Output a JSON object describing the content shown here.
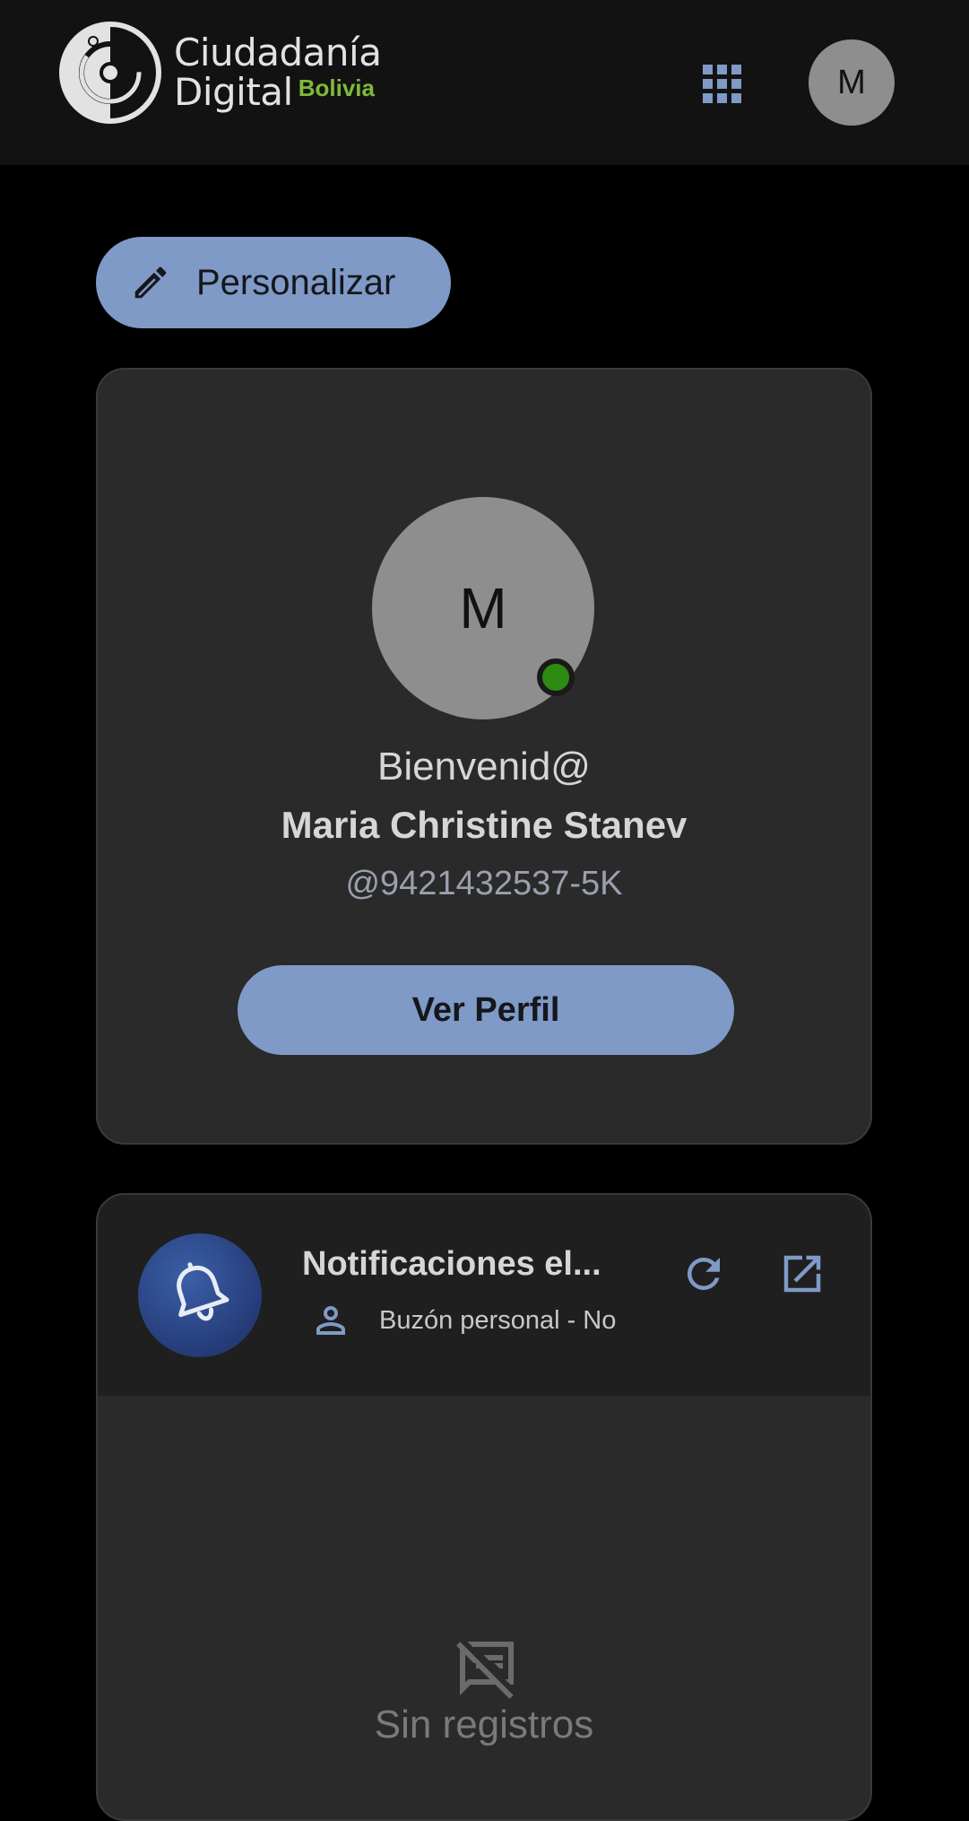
{
  "header": {
    "logo_line1": "Ciudadanía",
    "logo_line2": "Digital",
    "logo_country": "Bolivia",
    "apps_icon": "grid-apps-icon",
    "avatar_initial": "M"
  },
  "toolbar": {
    "personalize_label": "Personalizar",
    "personalize_icon": "pencil-icon"
  },
  "profile": {
    "avatar_initial": "M",
    "status": "online",
    "welcome": "Bienvenid@",
    "full_name": "Maria Christine Stanev",
    "username": "@9421432537-5K",
    "view_profile_label": "Ver Perfil"
  },
  "notifications": {
    "title": "Notificaciones el...",
    "subtitle": "Buzón personal - No",
    "icon": "bell-icon",
    "person_icon": "person-icon",
    "refresh_icon": "refresh-icon",
    "open_icon": "open-external-icon",
    "empty_text": "Sin registros",
    "empty_icon": "no-messages-icon"
  },
  "colors": {
    "accent": "#7f9ac6",
    "background": "#000000",
    "card": "#2a2a2a",
    "topbar": "#121212",
    "status_online": "#2d8a12",
    "brand_green": "#7dba3a"
  }
}
